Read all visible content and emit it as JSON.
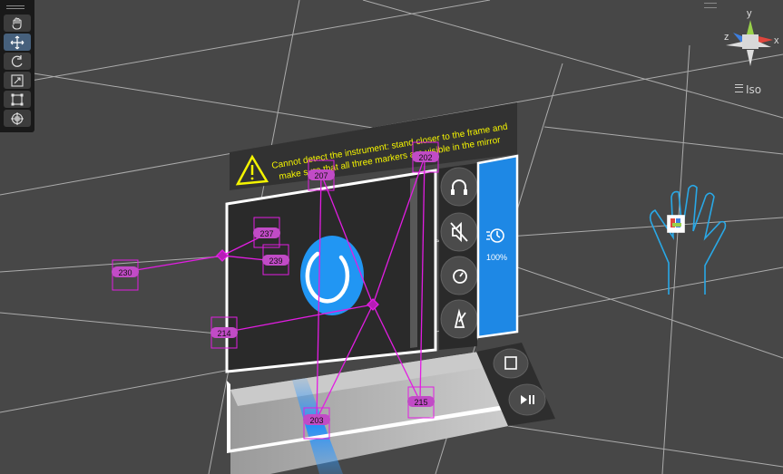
{
  "toolbar": {
    "tools": [
      {
        "name": "hand-tool",
        "icon": "hand-icon",
        "active": false
      },
      {
        "name": "move-tool",
        "icon": "move-arrows-icon",
        "active": true
      },
      {
        "name": "rotate-tool",
        "icon": "rotate-icon",
        "active": false
      },
      {
        "name": "scale-tool",
        "icon": "scale-icon",
        "active": false
      },
      {
        "name": "rect-tool",
        "icon": "rect-transform-icon",
        "active": false
      },
      {
        "name": "transform-tool",
        "icon": "transform-gizmo-icon",
        "active": false
      }
    ]
  },
  "gizmo": {
    "axis_y": "y",
    "axis_x": "x",
    "axis_z": "z",
    "view_label": "Iso",
    "colors": {
      "x": "#e0463d",
      "y": "#98d14a",
      "z": "#3d7fe0"
    }
  },
  "panel": {
    "warning_line1": "Cannot detect the instrument: stand closer to the frame and",
    "warning_line2": "make sure that all three markers are visible in the mirror",
    "volume_percent": "100%",
    "accent": "#2196f3",
    "warning_color": "#f4f400",
    "side_icons": [
      "headphones-icon",
      "mute-icon",
      "timer-icon",
      "metronome-icon"
    ],
    "bottom_icons": [
      "book-icon",
      "play-pause-icon"
    ]
  },
  "markers": [
    {
      "id": "230"
    },
    {
      "id": "237"
    },
    {
      "id": "239"
    },
    {
      "id": "214"
    },
    {
      "id": "207"
    },
    {
      "id": "202"
    },
    {
      "id": "203"
    },
    {
      "id": "215"
    }
  ],
  "colors": {
    "marker": "#e21de2",
    "background": "#474747",
    "grid": "#bdbdbd"
  }
}
